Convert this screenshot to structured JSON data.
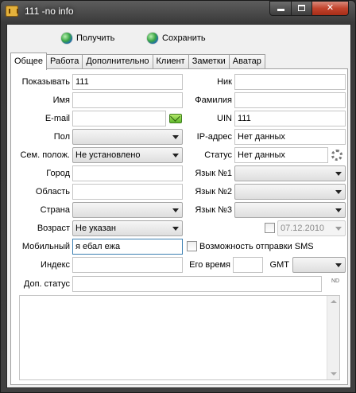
{
  "window": {
    "title": "111 -no info"
  },
  "toolbar": {
    "get_label": "Получить",
    "save_label": "Сохранить"
  },
  "tabs": [
    "Общее",
    "Работа",
    "Дополнительно",
    "Клиент",
    "Заметки",
    "Аватар"
  ],
  "left": {
    "display_label": "Показывать",
    "display_value": "111",
    "name_label": "Имя",
    "name_value": "",
    "email_label": "E-mail",
    "email_value": "",
    "gender_label": "Пол",
    "gender_value": "",
    "marital_label": "Сем. полож.",
    "marital_value": "Не установлено",
    "city_label": "Город",
    "city_value": "",
    "region_label": "Область",
    "region_value": "",
    "country_label": "Страна",
    "country_value": "",
    "age_label": "Возраст",
    "age_value": "Не указан",
    "mobile_label": "Мобильный",
    "mobile_value": "я ебал ежа",
    "zip_label": "Индекс",
    "zip_value": "",
    "extstatus_label": "Доп. статус",
    "extstatus_value": ""
  },
  "right": {
    "nick_label": "Ник",
    "nick_value": "",
    "surname_label": "Фамилия",
    "surname_value": "",
    "uin_label": "UIN",
    "uin_value": "111",
    "ip_label": "IP-адрес",
    "ip_value": "Нет данных",
    "status_label": "Статус",
    "status_value": "Нет данных",
    "lang1_label": "Язык №1",
    "lang1_value": "",
    "lang2_label": "Язык №2",
    "lang2_value": "",
    "lang3_label": "Язык №3",
    "lang3_value": "",
    "birth_date": "07.12.2010",
    "sms_label": "Возможность отправки SMS",
    "time_label": "Его время",
    "time_value": "",
    "gmt_label": "GMT",
    "gmt_value": ""
  },
  "icons": {
    "email": "mail-icon",
    "status": "gear-icon",
    "extstatus": "nd-icon"
  },
  "nd_text": "ND"
}
